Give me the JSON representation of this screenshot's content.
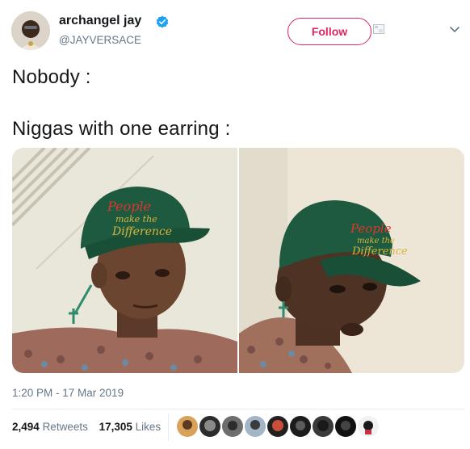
{
  "tweet": {
    "author_name": "archangel jay",
    "author_handle": "@JAYVERSACE",
    "follow_label": "Follow",
    "line1": "Nobody :",
    "line2": "Niggas with one earring :",
    "timestamp": "1:20 PM - 17 Mar 2019",
    "retweets_count": "2,494",
    "retweets_label": "Retweets",
    "likes_count": "17,305",
    "likes_label": "Likes",
    "cap_text": "People make the Difference"
  },
  "colors": {
    "follow_accent": "#e0245e",
    "verified_blue": "#1da1f2",
    "secondary_text": "#657786",
    "cap_green": "#1e5a3f"
  },
  "icons": {
    "verified": "verified-badge-icon",
    "more": "chevron-down-icon"
  }
}
